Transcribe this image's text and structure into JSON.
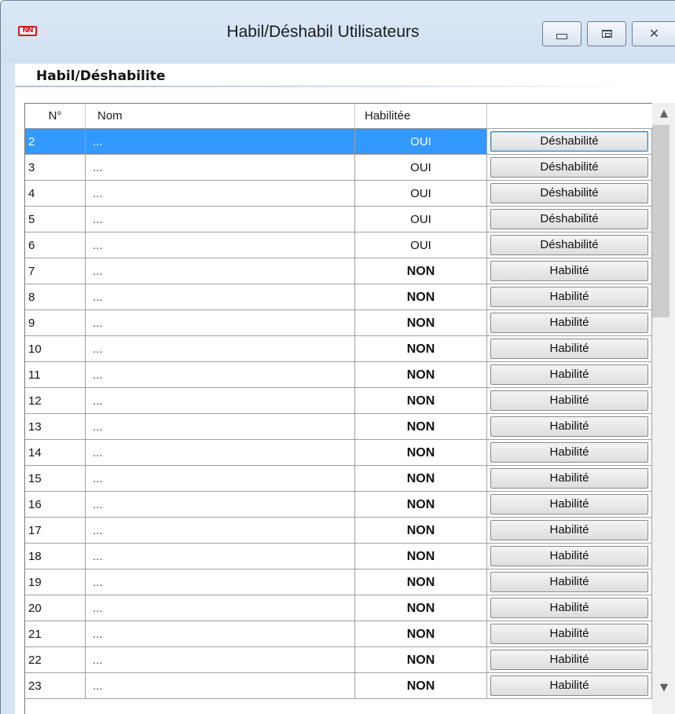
{
  "window": {
    "title": "Habil/Déshabil Utilisateurs",
    "app_icon_text": "NN",
    "minimize_icon": "minimize-icon",
    "maximize_icon": "maximize-icon",
    "close_icon": "close-icon"
  },
  "section": {
    "title": "Habil/Déshabilite"
  },
  "grid": {
    "headers": {
      "num": "N°",
      "nom": "Nom",
      "habilitee": "Habilitée",
      "action": ""
    },
    "rows": [
      {
        "num": "2",
        "nom": "...",
        "habilitee": "OUI",
        "action": "Déshabilité",
        "selected": true
      },
      {
        "num": "3",
        "nom": "...",
        "habilitee": "OUI",
        "action": "Déshabilité"
      },
      {
        "num": "4",
        "nom": "...",
        "habilitee": "OUI",
        "action": "Déshabilité"
      },
      {
        "num": "5",
        "nom": "...",
        "habilitee": "OUI",
        "action": "Déshabilité"
      },
      {
        "num": "6",
        "nom": "...",
        "habilitee": "OUI",
        "action": "Déshabilité"
      },
      {
        "num": "7",
        "nom": "...",
        "habilitee": "NON",
        "action": "Habilité"
      },
      {
        "num": "8",
        "nom": "...",
        "habilitee": "NON",
        "action": "Habilité"
      },
      {
        "num": "9",
        "nom": "...",
        "habilitee": "NON",
        "action": "Habilité"
      },
      {
        "num": "10",
        "nom": "...",
        "habilitee": "NON",
        "action": "Habilité"
      },
      {
        "num": "11",
        "nom": "...",
        "habilitee": "NON",
        "action": "Habilité"
      },
      {
        "num": "12",
        "nom": "...",
        "habilitee": "NON",
        "action": "Habilité"
      },
      {
        "num": "13",
        "nom": "...",
        "habilitee": "NON",
        "action": "Habilité"
      },
      {
        "num": "14",
        "nom": "...",
        "habilitee": "NON",
        "action": "Habilité"
      },
      {
        "num": "15",
        "nom": "...",
        "habilitee": "NON",
        "action": "Habilité"
      },
      {
        "num": "16",
        "nom": "...",
        "habilitee": "NON",
        "action": "Habilité"
      },
      {
        "num": "17",
        "nom": "...",
        "habilitee": "NON",
        "action": "Habilité"
      },
      {
        "num": "18",
        "nom": "...",
        "habilitee": "NON",
        "action": "Habilité"
      },
      {
        "num": "19",
        "nom": "...",
        "habilitee": "NON",
        "action": "Habilité"
      },
      {
        "num": "20",
        "nom": "...",
        "habilitee": "NON",
        "action": "Habilité"
      },
      {
        "num": "21",
        "nom": "...",
        "habilitee": "NON",
        "action": "Habilité"
      },
      {
        "num": "22",
        "nom": "...",
        "habilitee": "NON",
        "action": "Habilité"
      },
      {
        "num": "23",
        "nom": "...",
        "habilitee": "NON",
        "action": "Habilité"
      }
    ]
  },
  "scrollbar": {
    "up_icon": "chevron-up-icon",
    "down_icon": "chevron-down-icon"
  },
  "colors": {
    "selection": "#3399ff",
    "window_frame": "#d7e4f2",
    "app_icon": "#d11a1a"
  }
}
